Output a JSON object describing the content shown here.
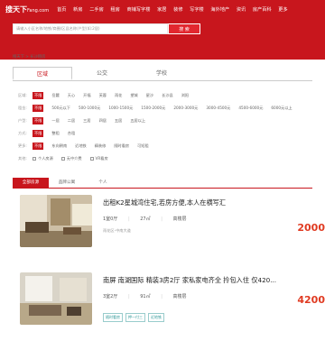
{
  "header": {
    "logo_main": "搜天下",
    "logo_sub": "Fang.com",
    "nav": [
      "首页",
      "新房",
      "二手房",
      "租房",
      "商铺写字楼",
      "家居",
      "装修",
      "写字楼",
      "海外地产",
      "资讯",
      "房产百科",
      "更多"
    ]
  },
  "search": {
    "placeholder": "请输入小区名称/地铁/商圈/区县名称/户型(如:2居)",
    "button_label": "搜 索"
  },
  "breadcrumb": "搜天下 > 长沙租房",
  "tabs": [
    "区域",
    "公交",
    "学校"
  ],
  "filters": [
    {
      "label": "区域:",
      "options": [
        "不限",
        "岳麓",
        "天心",
        "开福",
        "芙蓉",
        "雨花",
        "望城",
        "星沙",
        "长沙县",
        "浏阳"
      ],
      "selected": 0
    },
    {
      "label": "租金:",
      "options": [
        "不限",
        "500元以下",
        "500-1000元",
        "1000-1500元",
        "1500-2000元",
        "2000-3000元",
        "3000-4500元",
        "4500-6000元",
        "6000元以上"
      ],
      "selected": 0
    },
    {
      "label": "户型:",
      "options": [
        "不限",
        "一居",
        "二居",
        "三居",
        "四居",
        "五居",
        "五居以上"
      ],
      "selected": 0
    },
    {
      "label": "方式:",
      "options": [
        "不限",
        "整租",
        "合租"
      ],
      "selected": 0
    },
    {
      "label": "更多:",
      "options": [
        "不限",
        "东向朝南",
        "近地铁",
        "精装修",
        "随时看房",
        "可短租"
      ],
      "selected": 0
    },
    {
      "label": "其他:",
      "options": [
        "个人房源",
        "无中介费",
        "VR看房"
      ],
      "selected": -1
    }
  ],
  "result_tabs": [
    "全部房源",
    "品牌公寓",
    "个人"
  ],
  "listings": [
    {
      "title": "出租K2星城湾住宅,若房方便,本人在横写汇",
      "layout": "1室0厅",
      "area": "27㎡",
      "floor": "高楼层",
      "region": "雨花区-中南大道",
      "price": "2000",
      "tags": []
    },
    {
      "title": "南屏 南湖国际 精装3房2厅 家私家电齐全 拎包入住 仅420...",
      "layout": "3室2厅",
      "area": "91㎡",
      "floor": "高楼层",
      "region": "",
      "price": "4200",
      "tags": [
        "随时看房",
        "押一付三",
        "近地铁"
      ]
    }
  ],
  "colors": {
    "brand_red": "#c8161d",
    "price_red": "#e03a21"
  }
}
